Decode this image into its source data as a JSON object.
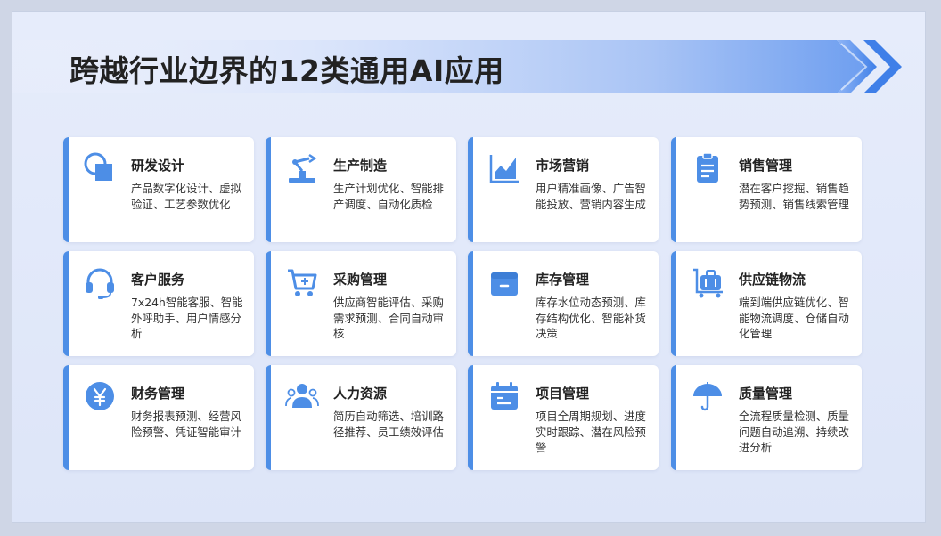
{
  "title": "跨越行业边界的12类通用AI应用",
  "accent_color": "#4d8ee6",
  "cards": [
    {
      "icon": "design-icon",
      "title": "研发设计",
      "desc": "产品数字化设计、虚拟验证、工艺参数优化"
    },
    {
      "icon": "robot-arm-icon",
      "title": "生产制造",
      "desc": "生产计划优化、智能排产调度、自动化质检"
    },
    {
      "icon": "area-chart-icon",
      "title": "市场营销",
      "desc": "用户精准画像、广告智能投放、营销内容生成"
    },
    {
      "icon": "clipboard-icon",
      "title": "销售管理",
      "desc": "潜在客户挖掘、销售趋势预测、销售线索管理"
    },
    {
      "icon": "headset-icon",
      "title": "客户服务",
      "desc": "7x24h智能客服、智能外呼助手、用户情感分析"
    },
    {
      "icon": "shopping-cart-icon",
      "title": "采购管理",
      "desc": "供应商智能评估、采购需求预测、合同自动审核"
    },
    {
      "icon": "inventory-box-icon",
      "title": "库存管理",
      "desc": "库存水位动态预测、库存结构优化、智能补货决策"
    },
    {
      "icon": "luggage-cart-icon",
      "title": "供应链物流",
      "desc": "端到端供应链优化、智能物流调度、仓储自动化管理"
    },
    {
      "icon": "yen-coin-icon",
      "title": "财务管理",
      "desc": "财务报表预测、经营风险预警、凭证智能审计"
    },
    {
      "icon": "people-icon",
      "title": "人力资源",
      "desc": "简历自动筛选、培训路径推荐、员工绩效评估"
    },
    {
      "icon": "calendar-icon",
      "title": "项目管理",
      "desc": "项目全周期规划、进度实时跟踪、潜在风险预警"
    },
    {
      "icon": "umbrella-icon",
      "title": "质量管理",
      "desc": "全流程质量检测、质量问题自动追溯、持续改进分析"
    }
  ]
}
